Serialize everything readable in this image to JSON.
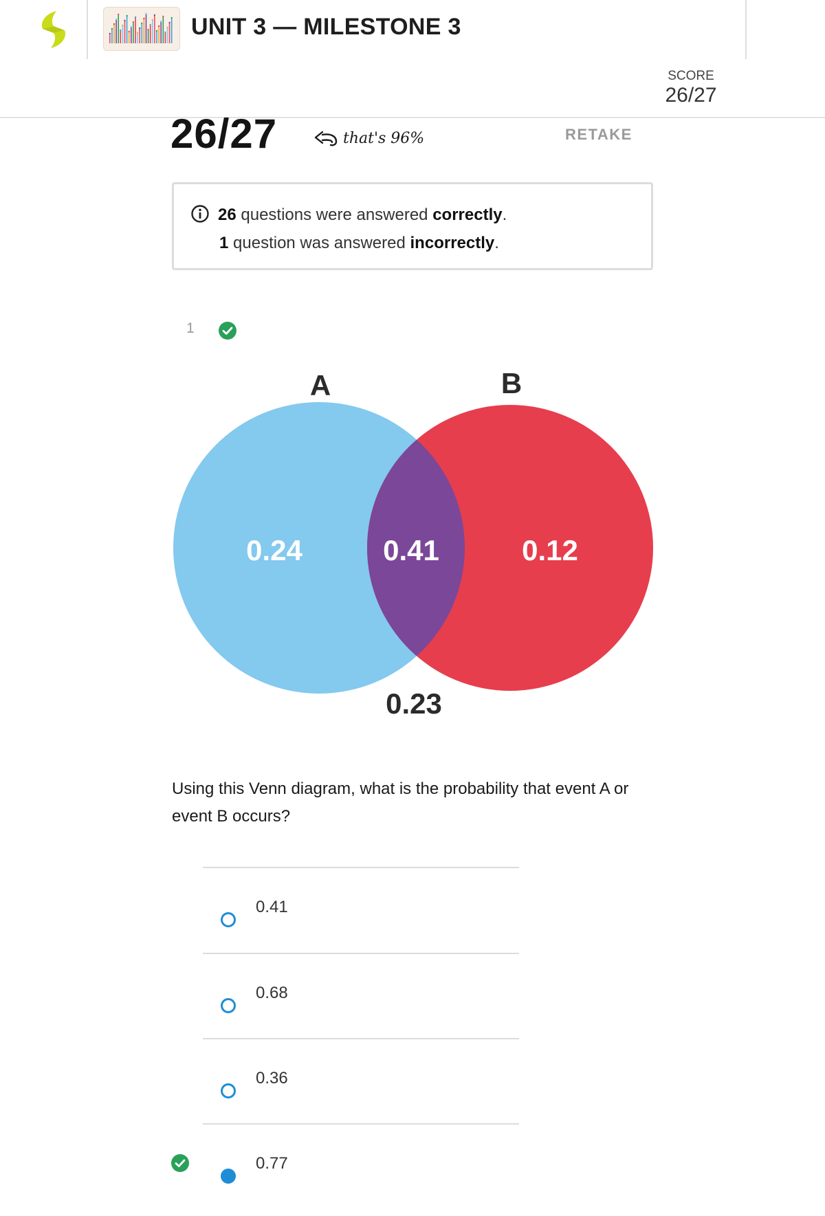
{
  "header": {
    "unit_title": "UNIT 3 — MILESTONE 3",
    "score_label": "SCORE",
    "score_value": "26/27",
    "brand_color": "#c9dc1a",
    "thumbnail_icon": "bar-chart-thumbnail-icon"
  },
  "result": {
    "big_score": "26/27",
    "note": "that's 96%",
    "retake_label": "RETAKE",
    "correct_count": "26",
    "correct_text_a": " questions were answered ",
    "correct_word": "correctly",
    "incorrect_count": "1",
    "incorrect_text_a": " question was answered ",
    "incorrect_word": "incorrectly",
    "period": "."
  },
  "question": {
    "number": "1",
    "status": "correct",
    "status_color": "#2aa05a",
    "text": "Using this Venn diagram, what is the probability that event A or event B occurs?",
    "venn": {
      "label_a": "A",
      "label_b": "B",
      "only_a": "0.24",
      "both": "0.41",
      "only_b": "0.12",
      "neither": "0.23",
      "color_a": "#84c9ee",
      "color_b": "#e63e4d",
      "color_both": "#7b4799"
    },
    "choices": [
      {
        "label": "0.41",
        "selected": false
      },
      {
        "label": "0.68",
        "selected": false
      },
      {
        "label": "0.36",
        "selected": false
      },
      {
        "label": "0.77",
        "selected": true,
        "correct": true
      }
    ],
    "radio_color": "#1f8dd6"
  }
}
